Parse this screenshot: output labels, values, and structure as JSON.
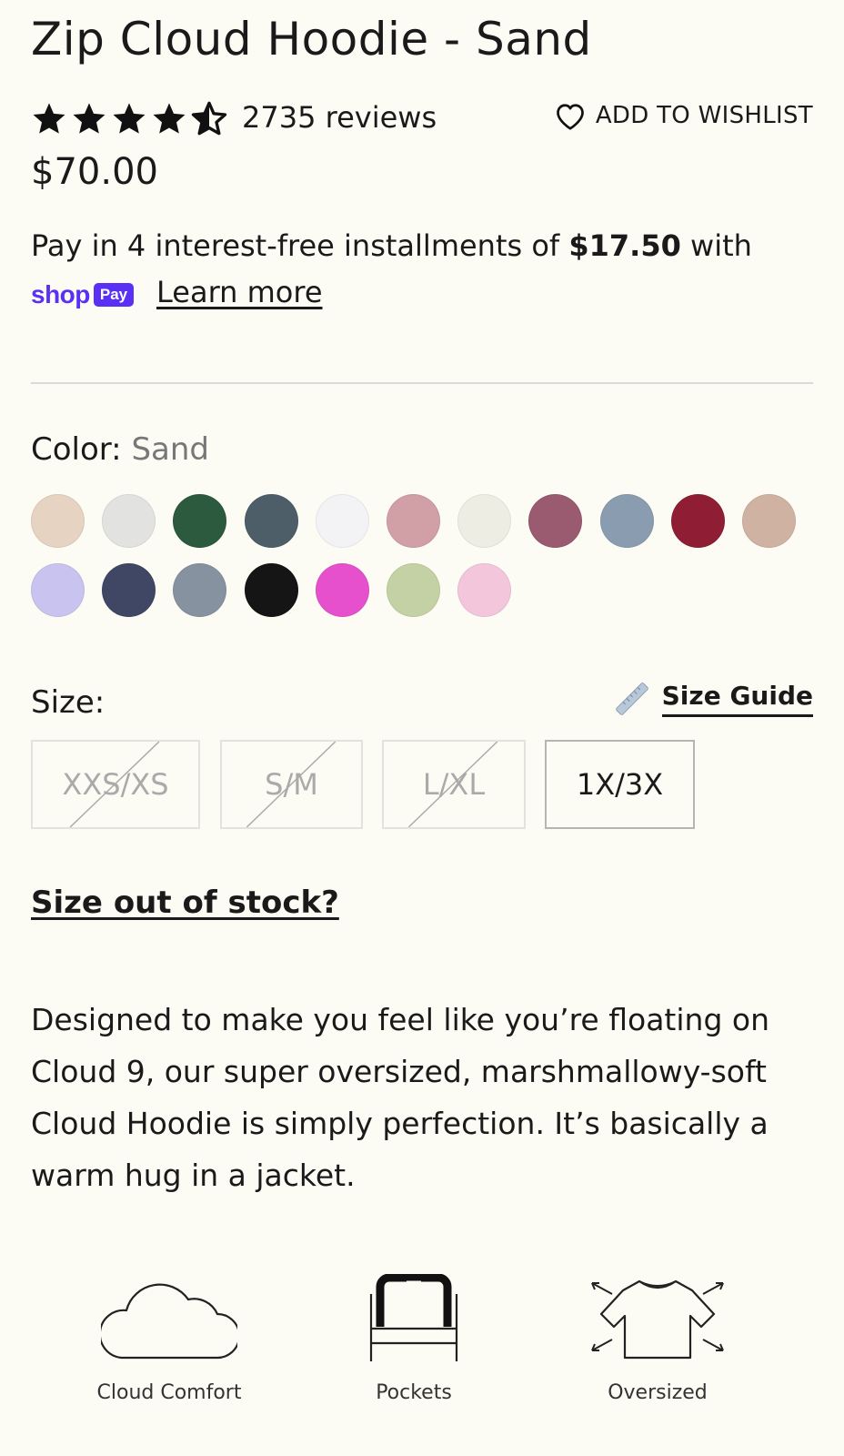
{
  "product": {
    "title": "Zip Cloud Hoodie - Sand",
    "rating": 4.5,
    "reviews": "2735 reviews",
    "wishlist_label": "ADD TO WISHLIST",
    "price": "$70.00"
  },
  "payment": {
    "prefix": "Pay in 4 interest-free installments of ",
    "amount": "$17.50",
    "suffix": " with",
    "shop_text": "shop",
    "pay_badge": "Pay",
    "learn_more": "Learn more"
  },
  "color": {
    "label": "Color: ",
    "selected": "Sand",
    "swatches": [
      "#e6d3c1",
      "#e2e2e0",
      "#2b5a3e",
      "#4d5e69",
      "#f3f3f6",
      "#d19fa6",
      "#ededE3",
      "#9a5a70",
      "#8a9db0",
      "#8f1e35",
      "#cfb2a2",
      "#c9c3ef",
      "#3f4765",
      "#8792a1",
      "#151515",
      "#e650cc",
      "#c3d1a4",
      "#f3c6dc"
    ]
  },
  "size": {
    "label": "Size:",
    "guide_label": "Size Guide",
    "options": [
      {
        "label": "XXS/XS",
        "available": false
      },
      {
        "label": "S/M",
        "available": false
      },
      {
        "label": "L/XL",
        "available": false
      },
      {
        "label": "1X/3X",
        "available": true,
        "selected": true
      }
    ],
    "oos_link": "Size out of stock?"
  },
  "description": "Designed to make you feel like you’re floating on Cloud 9, our super oversized, marshmallowy-soft Cloud Hoodie is simply perfection. It’s basically a warm hug in a jacket.",
  "features": [
    {
      "icon": "cloud-icon",
      "label": "Cloud Comfort"
    },
    {
      "icon": "pockets-icon",
      "label": "Pockets"
    },
    {
      "icon": "oversized-tshirt-icon",
      "label": "Oversized"
    }
  ]
}
